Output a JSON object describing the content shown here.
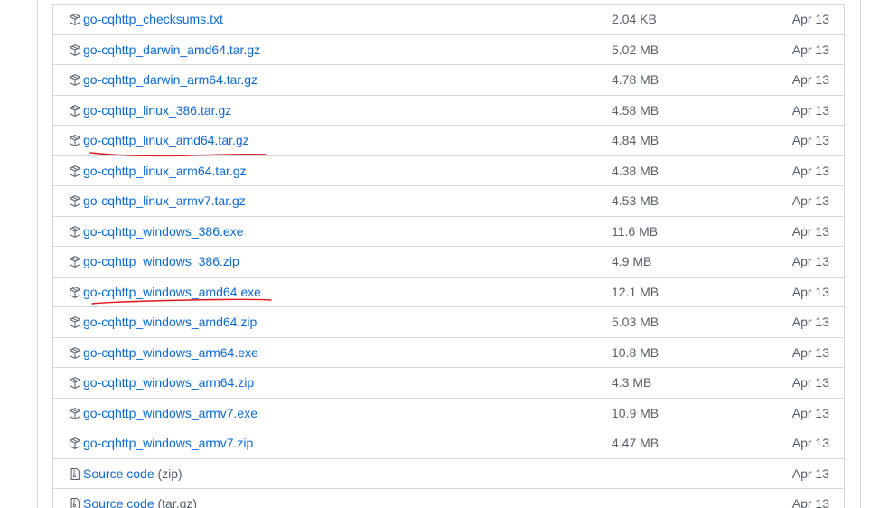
{
  "assets": [
    {
      "name": "go-cqhttp_checksums.txt",
      "size": "2.04 KB",
      "date": "Apr 13",
      "icon": "package-icon",
      "underlined": false
    },
    {
      "name": "go-cqhttp_darwin_amd64.tar.gz",
      "size": "5.02 MB",
      "date": "Apr 13",
      "icon": "package-icon",
      "underlined": false
    },
    {
      "name": "go-cqhttp_darwin_arm64.tar.gz",
      "size": "4.78 MB",
      "date": "Apr 13",
      "icon": "package-icon",
      "underlined": false
    },
    {
      "name": "go-cqhttp_linux_386.tar.gz",
      "size": "4.58 MB",
      "date": "Apr 13",
      "icon": "package-icon",
      "underlined": false
    },
    {
      "name": "go-cqhttp_linux_amd64.tar.gz",
      "size": "4.84 MB",
      "date": "Apr 13",
      "icon": "package-icon",
      "underlined": true
    },
    {
      "name": "go-cqhttp_linux_arm64.tar.gz",
      "size": "4.38 MB",
      "date": "Apr 13",
      "icon": "package-icon",
      "underlined": false
    },
    {
      "name": "go-cqhttp_linux_armv7.tar.gz",
      "size": "4.53 MB",
      "date": "Apr 13",
      "icon": "package-icon",
      "underlined": false
    },
    {
      "name": "go-cqhttp_windows_386.exe",
      "size": "11.6 MB",
      "date": "Apr 13",
      "icon": "package-icon",
      "underlined": false
    },
    {
      "name": "go-cqhttp_windows_386.zip",
      "size": "4.9 MB",
      "date": "Apr 13",
      "icon": "package-icon",
      "underlined": false
    },
    {
      "name": "go-cqhttp_windows_amd64.exe",
      "size": "12.1 MB",
      "date": "Apr 13",
      "icon": "package-icon",
      "underlined": true
    },
    {
      "name": "go-cqhttp_windows_amd64.zip",
      "size": "5.03 MB",
      "date": "Apr 13",
      "icon": "package-icon",
      "underlined": false
    },
    {
      "name": "go-cqhttp_windows_arm64.exe",
      "size": "10.8 MB",
      "date": "Apr 13",
      "icon": "package-icon",
      "underlined": false
    },
    {
      "name": "go-cqhttp_windows_arm64.zip",
      "size": "4.3 MB",
      "date": "Apr 13",
      "icon": "package-icon",
      "underlined": false
    },
    {
      "name": "go-cqhttp_windows_armv7.exe",
      "size": "10.9 MB",
      "date": "Apr 13",
      "icon": "package-icon",
      "underlined": false
    },
    {
      "name": "go-cqhttp_windows_armv7.zip",
      "size": "4.47 MB",
      "date": "Apr 13",
      "icon": "package-icon",
      "underlined": false
    },
    {
      "name": "Source code",
      "suffix": " (zip)",
      "size": "",
      "date": "Apr 13",
      "icon": "file-zip-icon",
      "underlined": false
    },
    {
      "name": "Source code",
      "suffix": " (tar.gz)",
      "size": "",
      "date": "Apr 13",
      "icon": "file-zip-icon",
      "underlined": false
    }
  ],
  "colors": {
    "link": "#0969da",
    "muted": "#57606a",
    "border": "#d0d7de",
    "annotation": "#e3161b"
  }
}
